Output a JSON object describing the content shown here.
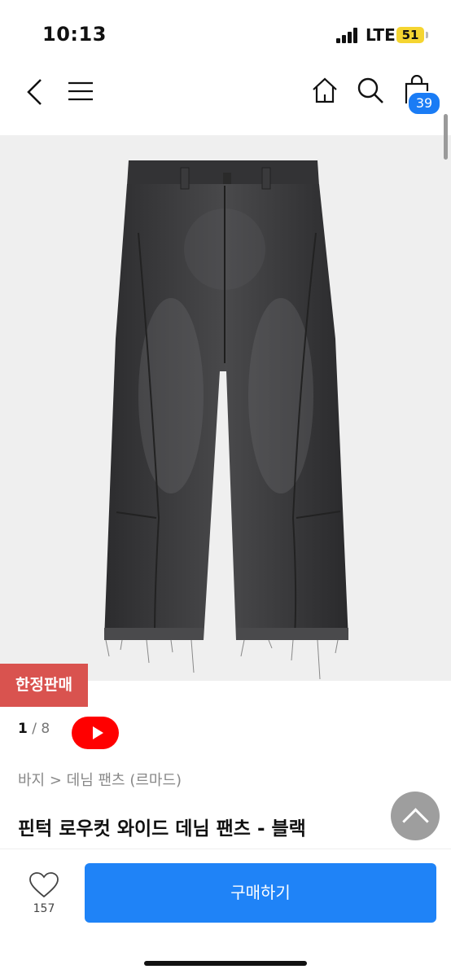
{
  "status_bar": {
    "time": "10:13",
    "network": "LTE",
    "battery": "51"
  },
  "nav": {
    "cart_count": "39"
  },
  "product": {
    "limited_label": "한정판매",
    "image_index": "1",
    "image_total": "8",
    "breadcrumb": "바지 > 데님 팬츠 (르마드)",
    "title": "핀턱 로우컷 와이드 데님 팬츠 - 블랙"
  },
  "bottom": {
    "like_count": "157",
    "buy_label": "구매하기"
  },
  "colors": {
    "accent": "#1f83f7",
    "limited": "#d9534f",
    "youtube": "#ff0000"
  }
}
